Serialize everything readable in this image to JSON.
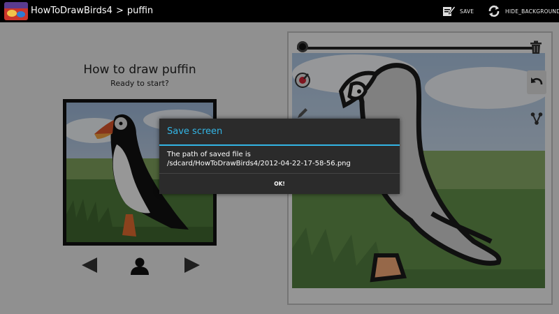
{
  "app": {
    "logo_icon": "how-to-draw-birds-logo-icon",
    "breadcrumb": {
      "root": "HowToDrawBirds4",
      "separator": ">",
      "current": "puffin"
    }
  },
  "toolbar": {
    "save_label": "SAVE",
    "save_icon": "edit-save-icon",
    "hide_background_label": "HIDE_BACKGROUND",
    "hide_background_icon": "refresh-icon"
  },
  "lesson": {
    "title": "How to draw puffin",
    "subtitle": "Ready to start?",
    "prev_icon": "triangle-left-icon",
    "person_icon": "person-icon",
    "next_icon": "triangle-right-icon"
  },
  "canvas_tools": {
    "brush_size_icon": "brush-dot-icon",
    "color_picker_icon": "color-picker-icon",
    "pencil_icon": "pencil-icon",
    "trash_icon": "trash-icon",
    "undo_icon": "undo-icon",
    "share_icon": "share-icon"
  },
  "dialog": {
    "title": "Save screen",
    "message_line1": "The path of saved file is",
    "message_line2": "/sdcard/HowToDrawBirds4/2012-04-22-17-58-56.png",
    "ok_label": "OK!"
  },
  "colors": {
    "accent": "#33b5e5",
    "dialog_bg": "#2b2b2b",
    "action_bar": "#000000",
    "background": "#e9e9e9"
  }
}
